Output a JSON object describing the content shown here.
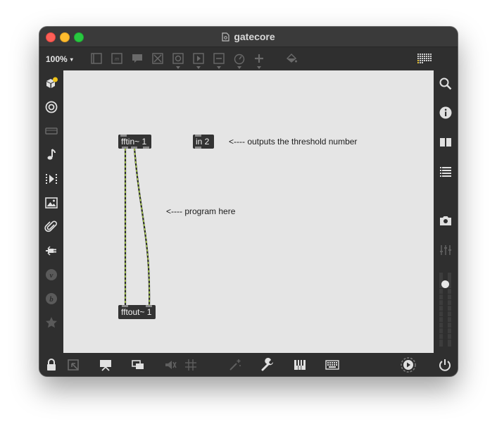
{
  "window": {
    "title": "gatecore",
    "colors": {
      "canvas": "#e5e5e5",
      "chrome": "#2f2f2f",
      "patchcord": "#b7e24a",
      "object": "#333333"
    }
  },
  "toolbar": {
    "zoom": "100%",
    "zoom_caret": "▾",
    "icons": [
      "presentation-icon",
      "message-icon",
      "comment-icon",
      "toggle-icon",
      "button-icon",
      "playlist-icon",
      "slider-icon",
      "dial-icon",
      "add-object-icon",
      "paint-bucket-icon",
      "grid-keyboard-icon"
    ]
  },
  "left_sidebar": {
    "icons": [
      "package-icon",
      "target-icon",
      "toolbar-strip-icon",
      "music-note-icon",
      "step-play-icon",
      "image-icon",
      "paperclip-icon",
      "plug-icon",
      "v-circle-icon",
      "b-circle-icon",
      "star-icon"
    ]
  },
  "right_sidebar": {
    "icons": [
      "search-icon",
      "info-icon",
      "book-icon",
      "list-icon",
      "camera-icon",
      "mixer-icon"
    ],
    "level": 0.85
  },
  "bottom_bar": {
    "icons": [
      "lock-icon",
      "presentation-mode-icon",
      "projector-icon",
      "windows-icon",
      "mute-icon",
      "grid-icon",
      "sparkle-icon",
      "wrench-icon",
      "piano-icon",
      "keyboard-icon",
      "transport-icon",
      "power-icon"
    ]
  },
  "patch": {
    "objects": [
      {
        "id": "fftin",
        "label": "fftin~ 1"
      },
      {
        "id": "in2",
        "label": "in 2"
      },
      {
        "id": "fftout",
        "label": "fftout~ 1"
      }
    ],
    "comments": [
      {
        "id": "threshold",
        "text": "<---- outputs the threshold number"
      },
      {
        "id": "program",
        "text": "<---- program here"
      }
    ]
  }
}
